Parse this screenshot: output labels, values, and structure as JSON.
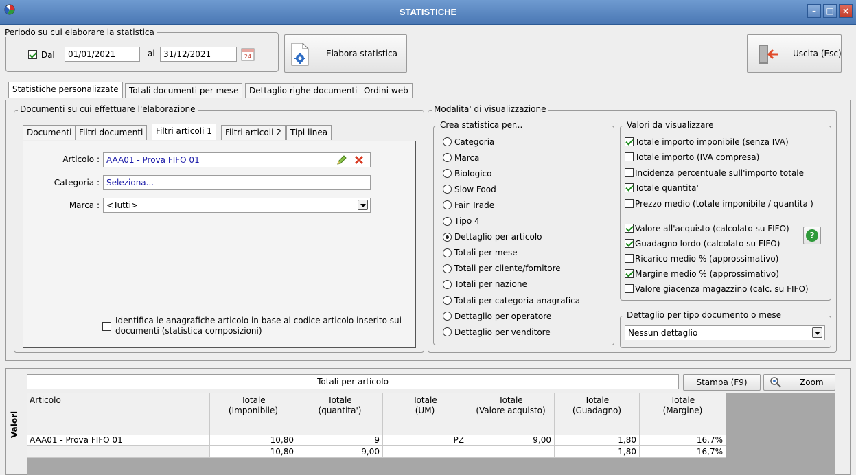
{
  "window": {
    "title": "STATISTICHE",
    "minimize": "–",
    "maximize": "□",
    "close": "×"
  },
  "period": {
    "legend": "Periodo su cui elaborare la statistica",
    "dal_label": "Dal",
    "dal_checked": true,
    "date_from": "01/01/2021",
    "al_label": "al",
    "date_to": "31/12/2021",
    "elabora_label": "Elabora statistica"
  },
  "exit_button": "Uscita (Esc)",
  "main_tabs": [
    "Statistiche personalizzate",
    "Totali documenti per mese",
    "Dettaglio righe documenti",
    "Ordini web"
  ],
  "documents": {
    "legend": "Documenti su cui effettuare l'elaborazione",
    "subtabs": [
      "Documenti",
      "Filtri documenti",
      "Filtri articoli 1",
      "Filtri articoli 2",
      "Tipi linea"
    ],
    "articolo_label": "Articolo :",
    "articolo_value": "AAA01 - Prova FIFO 01",
    "categoria_label": "Categoria :",
    "categoria_value": "Seleziona...",
    "marca_label": "Marca :",
    "marca_value": "<Tutti>",
    "identifica_line1": "Identifica le anagrafiche articolo in base al codice articolo inserito sui",
    "identifica_line2": "documenti (statistica composizioni)",
    "identifica_checked": false
  },
  "visualization": {
    "legend": "Modalita' di visualizzazione",
    "crea_legend": "Crea statistica per...",
    "options": [
      {
        "label": "Categoria",
        "selected": false
      },
      {
        "label": "Marca",
        "selected": false
      },
      {
        "label": "Biologico",
        "selected": false
      },
      {
        "label": "Slow Food",
        "selected": false
      },
      {
        "label": "Fair Trade",
        "selected": false
      },
      {
        "label": "Tipo 4",
        "selected": false
      },
      {
        "label": "Dettaglio per articolo",
        "selected": true
      },
      {
        "label": "Totali per mese",
        "selected": false
      },
      {
        "label": "Totali per cliente/fornitore",
        "selected": false
      },
      {
        "label": "Totali per nazione",
        "selected": false
      },
      {
        "label": "Totali per categoria anagrafica",
        "selected": false
      },
      {
        "label": "Dettaglio per operatore",
        "selected": false
      },
      {
        "label": "Dettaglio per venditore",
        "selected": false
      }
    ],
    "valori_legend": "Valori da visualizzare",
    "values": [
      {
        "label": "Totale importo imponibile (senza IVA)",
        "checked": true
      },
      {
        "label": "Totale importo (IVA compresa)",
        "checked": false
      },
      {
        "label": "Incidenza percentuale sull'importo totale",
        "checked": false
      },
      {
        "label": "Totale quantita'",
        "checked": true
      },
      {
        "label": "Prezzo medio (totale imponibile / quantita')",
        "checked": false
      },
      {
        "label": "Valore all'acquisto (calcolato su FIFO)",
        "checked": true
      },
      {
        "label": "Guadagno lordo (calcolato su FIFO)",
        "checked": true
      },
      {
        "label": "Ricarico medio % (approssimativo)",
        "checked": false
      },
      {
        "label": "Margine medio % (approssimativo)",
        "checked": true
      },
      {
        "label": "Valore giacenza magazzino (calc. su FIFO)",
        "checked": false
      }
    ],
    "dettaglio_legend": "Dettaglio per tipo documento o mese",
    "dettaglio_value": "Nessun dettaglio",
    "help_icon": "?"
  },
  "results": {
    "side_label": "Valori",
    "title": "Totali per articolo",
    "stampa_label": "Stampa (F9)",
    "zoom_label": "Zoom",
    "columns": [
      {
        "line1": "Articolo",
        "line2": ""
      },
      {
        "line1": "Totale",
        "line2": "(Imponibile)"
      },
      {
        "line1": "Totale",
        "line2": "(quantita')"
      },
      {
        "line1": "Totale",
        "line2": "(UM)"
      },
      {
        "line1": "Totale",
        "line2": "(Valore acquisto)"
      },
      {
        "line1": "Totale",
        "line2": "(Guadagno)"
      },
      {
        "line1": "Totale",
        "line2": "(Margine)"
      }
    ],
    "rows": [
      [
        "AAA01 - Prova FIFO 01",
        "10,80",
        "9",
        "PZ",
        "9,00",
        "1,80",
        "16,7%"
      ],
      [
        "",
        "10,80",
        "9,00",
        "",
        "",
        "1,80",
        "16,7%"
      ]
    ]
  }
}
